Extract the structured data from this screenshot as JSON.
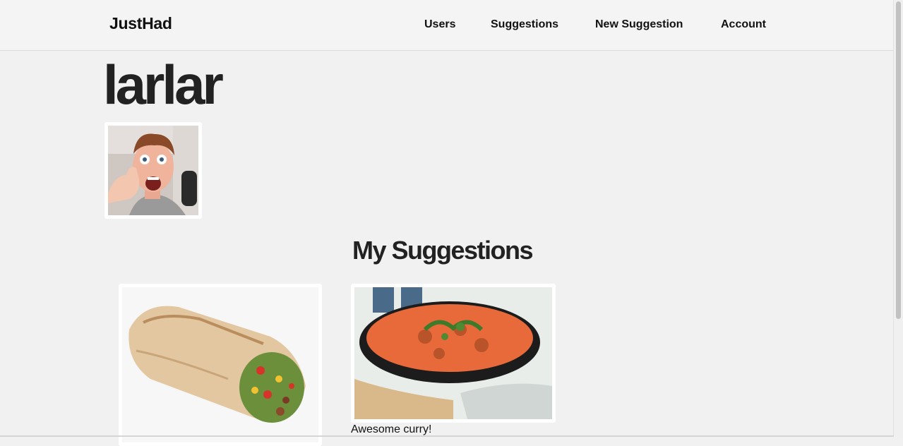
{
  "nav": {
    "brand": "JustHad",
    "links": [
      {
        "label": "Users"
      },
      {
        "label": "Suggestions"
      },
      {
        "label": "New Suggestion"
      },
      {
        "label": "Account"
      }
    ]
  },
  "profile": {
    "username": "larlar",
    "avatar_icon": "user-avatar-photo"
  },
  "suggestions": {
    "heading": "My Suggestions",
    "items": [
      {
        "image_icon": "burrito-photo",
        "caption": ""
      },
      {
        "image_icon": "curry-bowl-photo",
        "caption": "Awesome curry!"
      }
    ]
  }
}
